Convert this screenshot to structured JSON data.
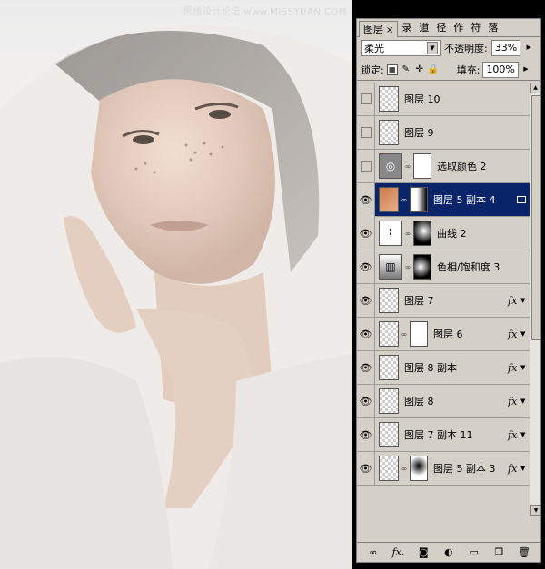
{
  "watermark": "思缘设计论坛 www.MISSYUAN.COM",
  "panel": {
    "tabs": [
      {
        "label": "图层",
        "active": true
      },
      {
        "label": "录"
      },
      {
        "label": "道"
      },
      {
        "label": "径"
      },
      {
        "label": "作"
      },
      {
        "label": "符"
      },
      {
        "label": "落"
      }
    ],
    "tab_close": "×",
    "blend_mode": "柔光",
    "opacity_label": "不透明度:",
    "opacity_value": "33%",
    "lock_label": "锁定:",
    "fill_label": "填充:",
    "fill_value": "100%",
    "layers": [
      {
        "name": "图层 10",
        "visible": false
      },
      {
        "name": "图层 9",
        "visible": false
      },
      {
        "name": "选取颜色 2",
        "visible": false
      },
      {
        "name": "图层 5 副本 4",
        "visible": true,
        "selected": true
      },
      {
        "name": "曲线 2",
        "visible": true
      },
      {
        "name": "色相/饱和度 3",
        "visible": true
      },
      {
        "name": "图层 7",
        "visible": true,
        "fx": true
      },
      {
        "name": "图层 6",
        "visible": true,
        "fx": true
      },
      {
        "name": "图层 8 副本",
        "visible": true,
        "fx": true
      },
      {
        "name": "图层 8",
        "visible": true,
        "fx": true
      },
      {
        "name": "图层 7 副本 11",
        "visible": true,
        "fx": true
      },
      {
        "name": "图层 5 副本 3",
        "visible": true,
        "fx": true
      }
    ],
    "fx_label": "fx",
    "bottom_fx": "fx."
  }
}
